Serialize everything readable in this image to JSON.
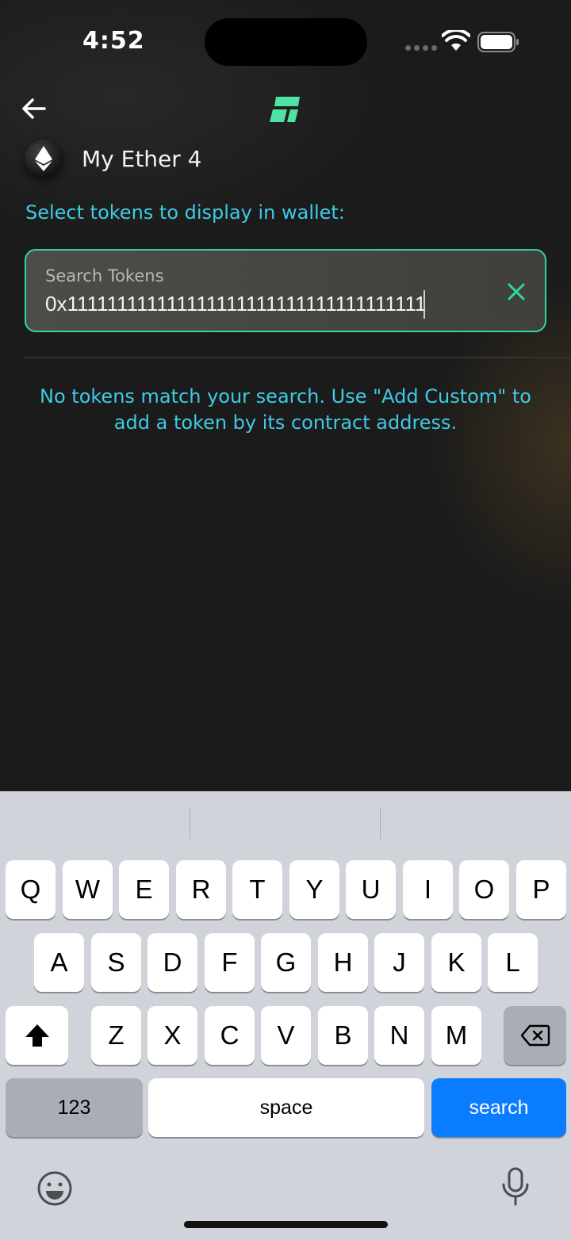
{
  "status_bar": {
    "time": "4:52"
  },
  "header": {
    "wallet_name": "My Ether 4"
  },
  "main": {
    "instruction": "Select tokens to display in wallet:",
    "search": {
      "placeholder": "Search Tokens",
      "value": "0x1111111111111111111111111111111111111111"
    },
    "empty_message": "No tokens match your search. Use \"Add Custom\" to add a token by its contract address."
  },
  "keyboard": {
    "row1": [
      "Q",
      "W",
      "E",
      "R",
      "T",
      "Y",
      "U",
      "I",
      "O",
      "P"
    ],
    "row2": [
      "A",
      "S",
      "D",
      "F",
      "G",
      "H",
      "J",
      "K",
      "L"
    ],
    "row3": [
      "Z",
      "X",
      "C",
      "V",
      "B",
      "N",
      "M"
    ],
    "numbers_label": "123",
    "space_label": "space",
    "search_label": "search"
  },
  "colors": {
    "accent_green": "#2fd8a0",
    "text_cyan": "#3ecbe6",
    "keyboard_blue": "#0a7cff"
  }
}
